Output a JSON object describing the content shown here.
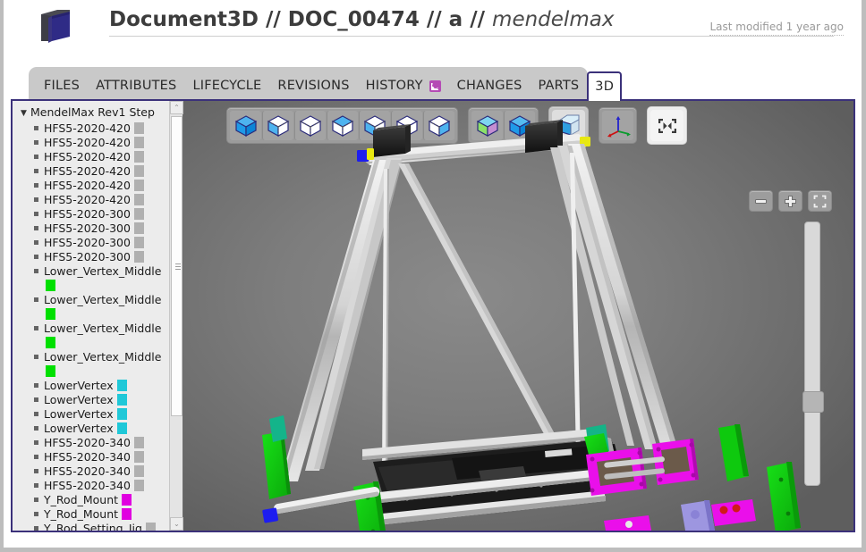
{
  "header": {
    "icon_name": "document3d-folder-icon",
    "title_parts": {
      "app": "Document3D",
      "sep1": "//",
      "doc_id": "DOC_00474",
      "sep2": "//",
      "revision": "a",
      "sep3": "//",
      "doc_name": "mendelmax"
    },
    "last_modified": "Last modified 1 year ago"
  },
  "tabs": [
    {
      "label": "FILES",
      "active": false,
      "icon": null
    },
    {
      "label": "ATTRIBUTES",
      "active": false,
      "icon": null
    },
    {
      "label": "LIFECYCLE",
      "active": false,
      "icon": null
    },
    {
      "label": "REVISIONS",
      "active": false,
      "icon": null
    },
    {
      "label": "HISTORY",
      "active": false,
      "icon": "rss-icon"
    },
    {
      "label": "CHANGES",
      "active": false,
      "icon": null
    },
    {
      "label": "PARTS",
      "active": false,
      "icon": null
    },
    {
      "label": "3D",
      "active": true,
      "icon": null
    }
  ],
  "tree": {
    "root": {
      "label": "MendelMax Rev1 Step",
      "expanded": true,
      "caret": "▼"
    },
    "items": [
      {
        "label": "HFS5-2020-420",
        "color": "#b0b0b0"
      },
      {
        "label": "HFS5-2020-420",
        "color": "#b0b0b0"
      },
      {
        "label": "HFS5-2020-420",
        "color": "#b0b0b0"
      },
      {
        "label": "HFS5-2020-420",
        "color": "#b0b0b0"
      },
      {
        "label": "HFS5-2020-420",
        "color": "#b0b0b0"
      },
      {
        "label": "HFS5-2020-420",
        "color": "#b0b0b0"
      },
      {
        "label": "HFS5-2020-300",
        "color": "#b0b0b0"
      },
      {
        "label": "HFS5-2020-300",
        "color": "#b0b0b0"
      },
      {
        "label": "HFS5-2020-300",
        "color": "#b0b0b0"
      },
      {
        "label": "HFS5-2020-300",
        "color": "#b0b0b0"
      },
      {
        "label": "Lower_Vertex_Middle",
        "color": "#00e000"
      },
      {
        "label": "Lower_Vertex_Middle",
        "color": "#00e000"
      },
      {
        "label": "Lower_Vertex_Middle",
        "color": "#00e000"
      },
      {
        "label": "Lower_Vertex_Middle",
        "color": "#00e000"
      },
      {
        "label": "LowerVertex",
        "color": "#1fc8d8"
      },
      {
        "label": "LowerVertex",
        "color": "#1fc8d8"
      },
      {
        "label": "LowerVertex",
        "color": "#1fc8d8"
      },
      {
        "label": "LowerVertex",
        "color": "#1fc8d8"
      },
      {
        "label": "HFS5-2020-340",
        "color": "#b0b0b0"
      },
      {
        "label": "HFS5-2020-340",
        "color": "#b0b0b0"
      },
      {
        "label": "HFS5-2020-340",
        "color": "#b0b0b0"
      },
      {
        "label": "HFS5-2020-340",
        "color": "#b0b0b0"
      },
      {
        "label": "Y_Rod_Mount",
        "color": "#e000e0"
      },
      {
        "label": "Y_Rod_Mount",
        "color": "#e000e0"
      },
      {
        "label": "Y_Rod_Setting_Jig",
        "color": "#b0b0b0"
      }
    ],
    "scrollbar": {
      "up_arrow": "⌃",
      "down_arrow": "⌄"
    }
  },
  "viewport": {
    "toolbar_groups": [
      {
        "name": "view-orientation-group",
        "buttons": [
          {
            "name": "view-shaded-button",
            "style": "solid"
          },
          {
            "name": "view-shaded-edges-button",
            "style": "solid-edges"
          },
          {
            "name": "view-wireframe-button",
            "style": "wire"
          },
          {
            "name": "view-wireframe-shaded-button",
            "style": "wire-top"
          },
          {
            "name": "view-hidden-line-button",
            "style": "wire-mid"
          },
          {
            "name": "view-hidden-line-removed-button",
            "style": "wire2"
          },
          {
            "name": "view-shaded-wire-button",
            "style": "wire-half"
          }
        ]
      },
      {
        "name": "render-mode-group",
        "buttons": [
          {
            "name": "render-color-cube-button",
            "style": "color-cube"
          },
          {
            "name": "render-blue-cube-button",
            "style": "blue-cube"
          }
        ]
      },
      {
        "name": "transparency-group",
        "buttons": [
          {
            "name": "transparency-toggle-button",
            "style": "transparent-cube",
            "active": true
          }
        ]
      },
      {
        "name": "axis-group",
        "buttons": [
          {
            "name": "axis-triad-button",
            "style": "axis"
          }
        ]
      },
      {
        "name": "fullscreen-group",
        "buttons": [
          {
            "name": "fit-to-screen-button",
            "style": "fit"
          }
        ]
      }
    ],
    "zoom_controls": [
      {
        "name": "zoom-out-button",
        "glyph": "−"
      },
      {
        "name": "zoom-in-button",
        "glyph": "+"
      },
      {
        "name": "zoom-fit-button",
        "glyph": "fit-brackets"
      }
    ],
    "zoom_slider": {
      "name": "zoom-slider",
      "thumb_position_percent": 64
    },
    "model_name": "mendelmax-3d-printer-frame"
  }
}
